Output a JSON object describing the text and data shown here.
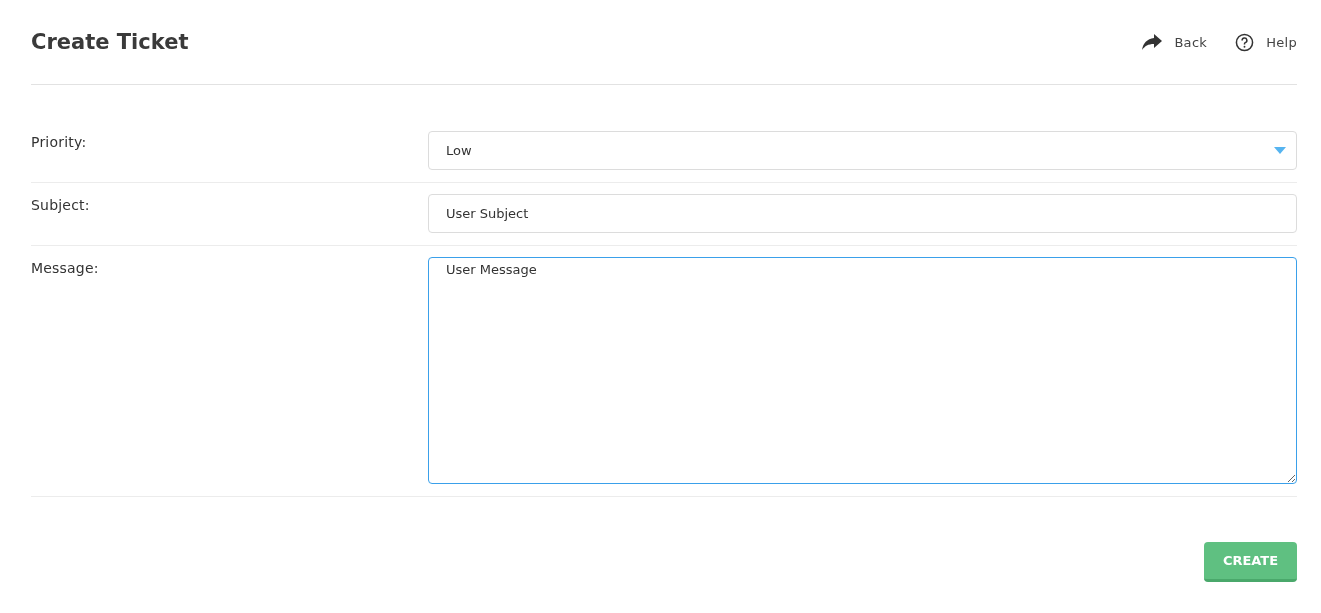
{
  "header": {
    "title": "Create Ticket",
    "actions": [
      {
        "kind": "back",
        "label": "Back"
      },
      {
        "kind": "help",
        "label": "Help"
      }
    ]
  },
  "fields": [
    {
      "kind": "select",
      "label": "Priority:",
      "value": "Low",
      "focused": false
    },
    {
      "kind": "text",
      "label": "Subject:",
      "value": "User Subject",
      "focused": false
    },
    {
      "kind": "textarea",
      "label": "Message:",
      "value": "User Message",
      "focused": true
    }
  ],
  "submit": {
    "label": "CREATE"
  }
}
